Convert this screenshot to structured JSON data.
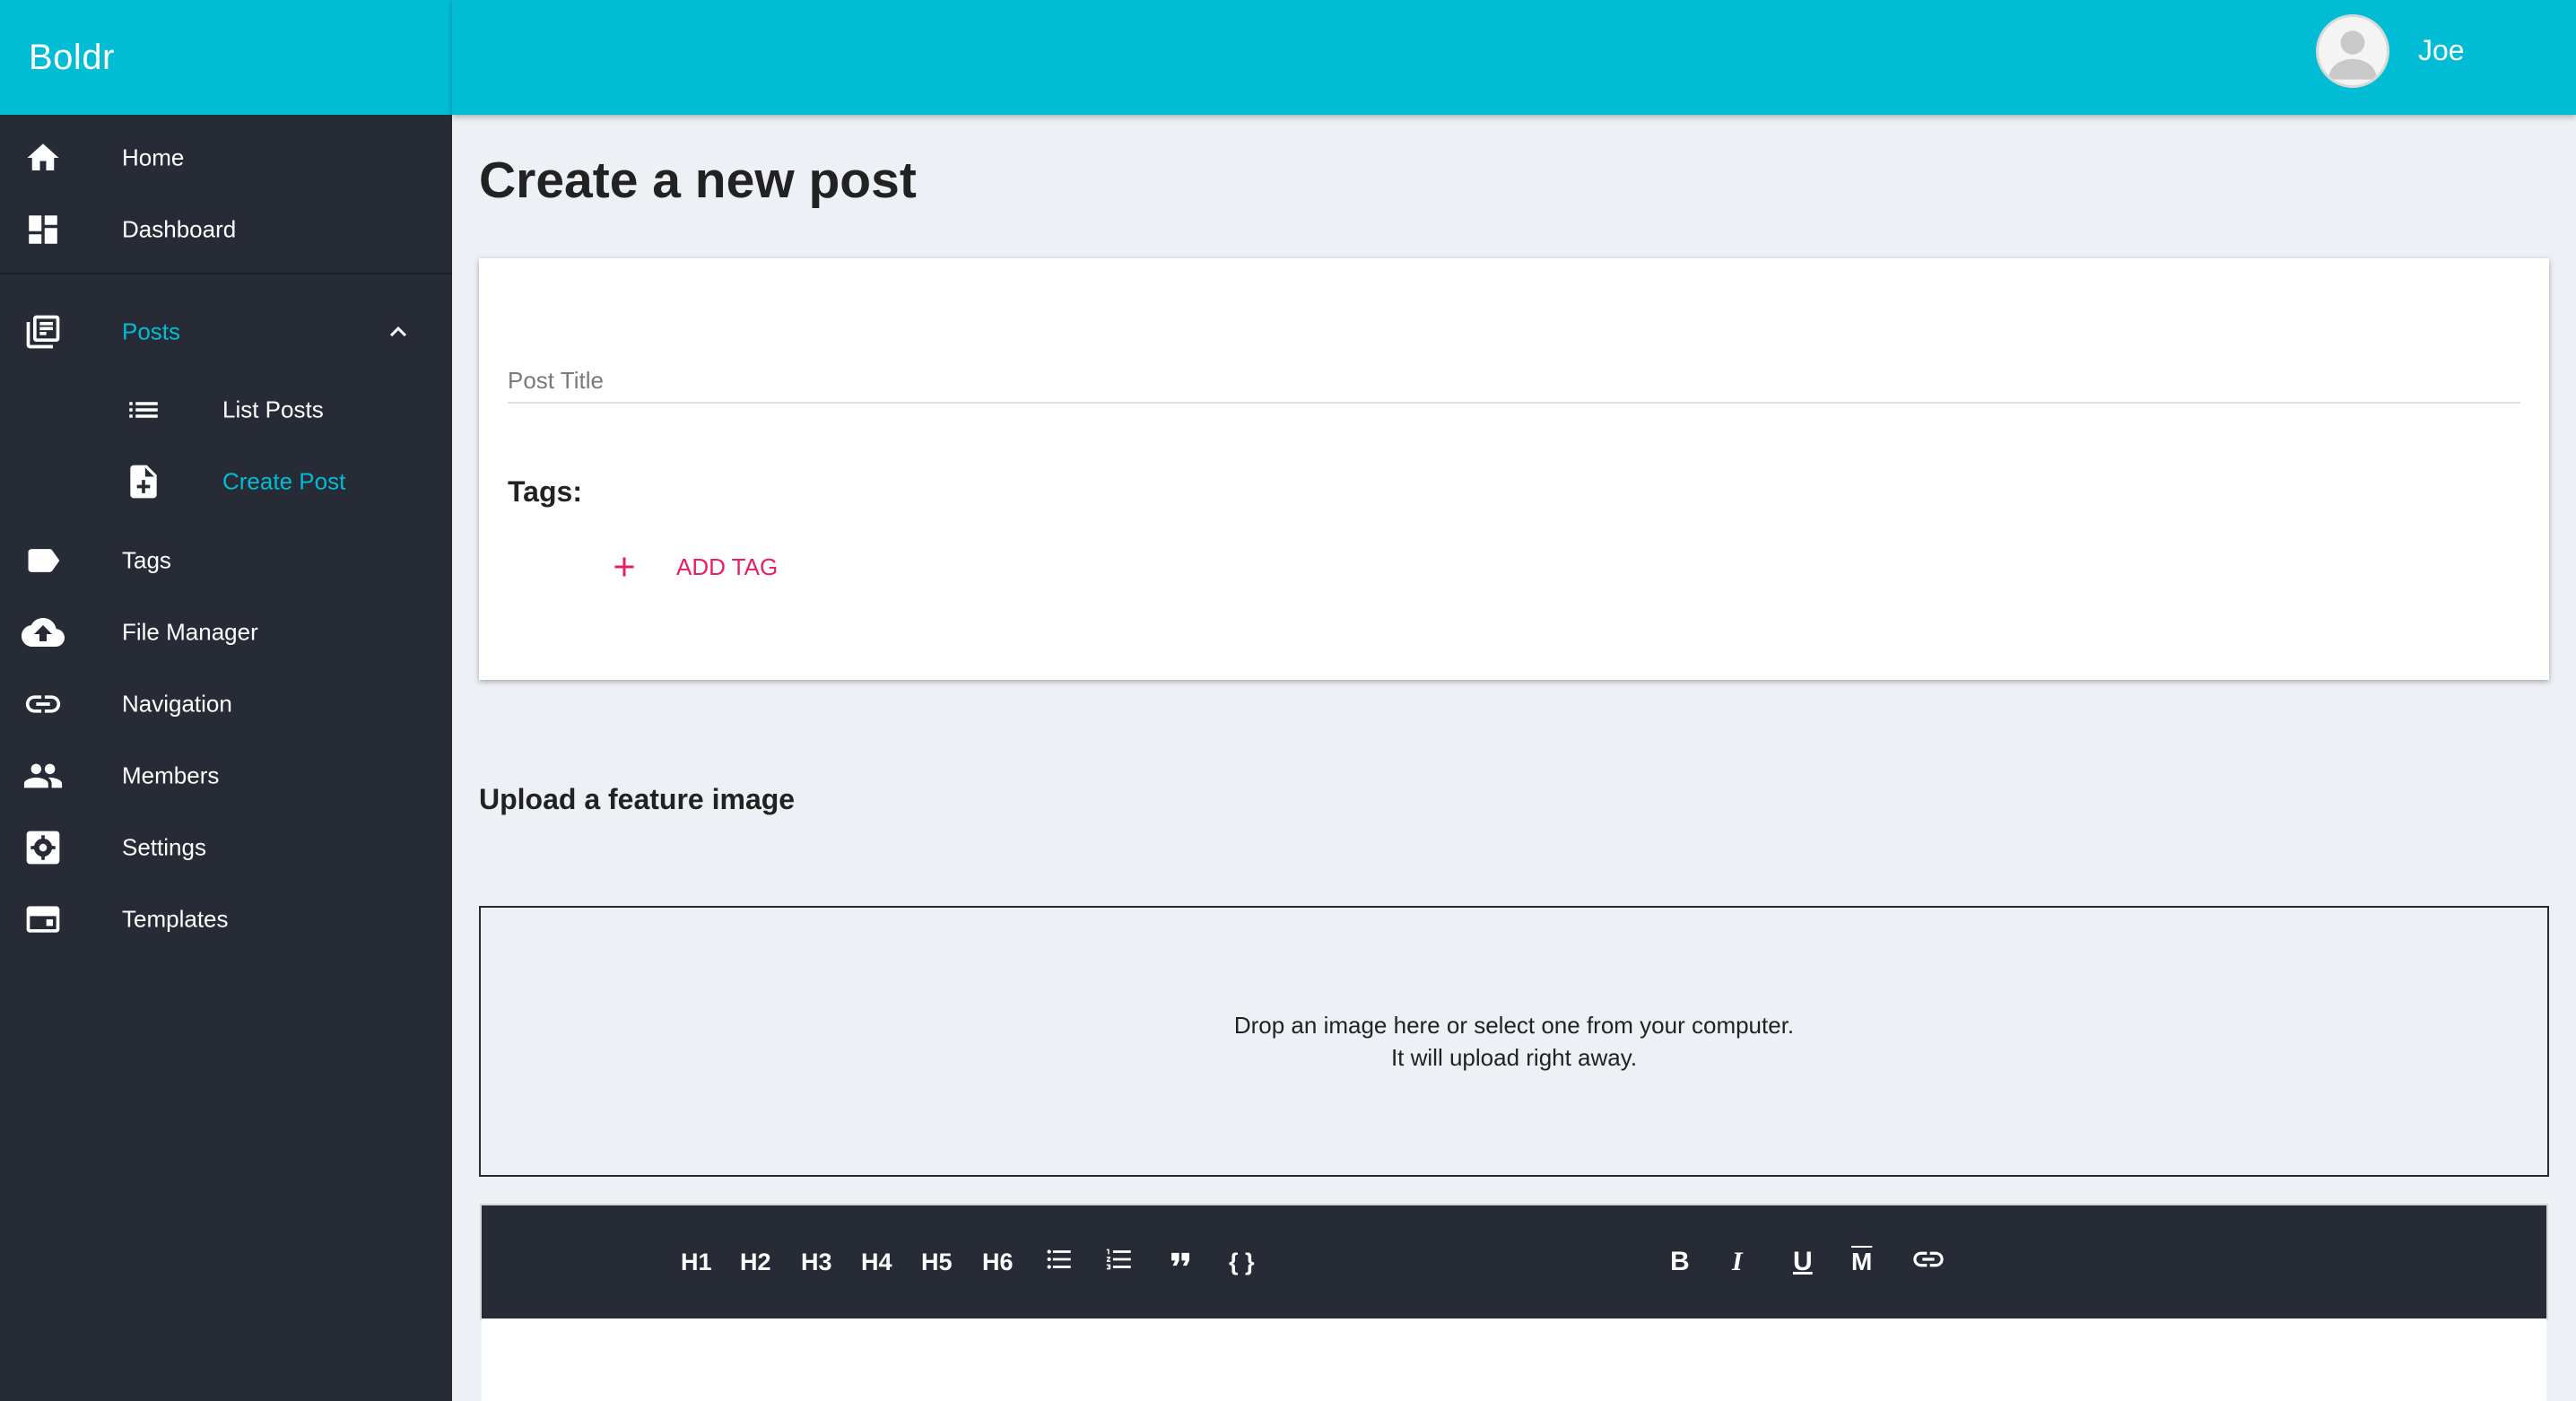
{
  "app": {
    "brand": "Boldr"
  },
  "user": {
    "name": "Joe"
  },
  "sidebar": {
    "items": [
      {
        "label": "Home",
        "icon": "home-icon"
      },
      {
        "label": "Dashboard",
        "icon": "dashboard-icon"
      },
      {
        "label": "Posts",
        "icon": "posts-icon",
        "expanded": true,
        "active": true
      },
      {
        "label": "List Posts",
        "icon": "list-icon"
      },
      {
        "label": "Create Post",
        "icon": "note-add-icon",
        "active": true
      },
      {
        "label": "Tags",
        "icon": "tag-icon"
      },
      {
        "label": "File Manager",
        "icon": "cloud-upload-icon"
      },
      {
        "label": "Navigation",
        "icon": "link-icon"
      },
      {
        "label": "Members",
        "icon": "people-icon"
      },
      {
        "label": "Settings",
        "icon": "settings-icon"
      },
      {
        "label": "Templates",
        "icon": "templates-icon"
      }
    ]
  },
  "main": {
    "title": "Create a new post",
    "post_title_placeholder": "Post Title",
    "post_title_value": "",
    "tags_label": "Tags:",
    "add_tag_label": "ADD TAG",
    "upload_heading": "Upload a feature image",
    "dropzone_line1": "Drop an image here or select one from your computer.",
    "dropzone_line2": "It will upload right away."
  },
  "editor": {
    "headings": [
      "H1",
      "H2",
      "H3",
      "H4",
      "H5",
      "H6"
    ],
    "code_label": "{ }",
    "format_buttons": [
      {
        "label": "B",
        "icon": "bold-icon"
      },
      {
        "label": "I",
        "icon": "italic-icon"
      },
      {
        "label": "U",
        "icon": "underline-icon"
      },
      {
        "label": "M",
        "icon": "strikethrough-icon"
      }
    ]
  },
  "colors": {
    "accent": "#00bcd4",
    "sidebar_bg": "#262b35",
    "page_bg": "#edf0f4",
    "add_tag": "#e91e63"
  }
}
